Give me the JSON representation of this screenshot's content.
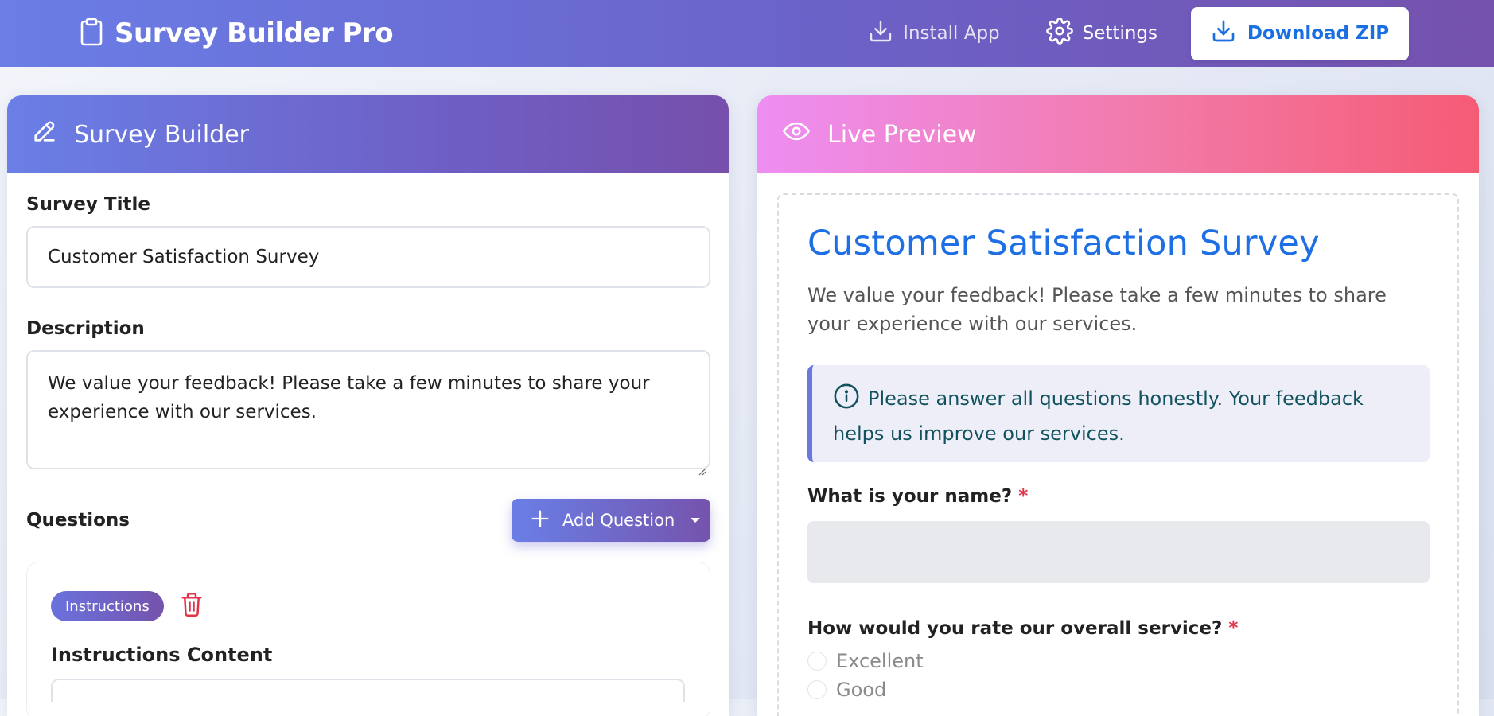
{
  "navbar": {
    "brand": "Survey Builder Pro",
    "install_label": "Install App",
    "settings_label": "Settings",
    "download_label": "Download ZIP"
  },
  "builder": {
    "header": "Survey Builder",
    "title_label": "Survey Title",
    "title_value": "Customer Satisfaction Survey",
    "description_label": "Description",
    "description_value": "We value your feedback! Please take a few minutes to share your experience with our services.",
    "questions_label": "Questions",
    "add_question_label": "Add Question",
    "question_card": {
      "badge": "Instructions",
      "content_label": "Instructions Content"
    }
  },
  "preview": {
    "header": "Live Preview",
    "title": "Customer Satisfaction Survey",
    "description": "We value your feedback! Please take a few minutes to share your experience with our services.",
    "info_text": "Please answer all questions honestly. Your feedback helps us improve our services.",
    "questions": [
      {
        "label": "What is your name?",
        "required": "*"
      },
      {
        "label": "How would you rate our overall service?",
        "required": "*",
        "options": [
          "Excellent",
          "Good"
        ]
      }
    ]
  },
  "colors": {
    "navbar_gradient_start": "#6a7ee6",
    "navbar_gradient_end": "#7552ad",
    "preview_gradient_start": "#ee8ef2",
    "preview_gradient_end": "#f55b75",
    "preview_title": "#1d6fe3",
    "required_asterisk": "#e0344a",
    "delete_icon": "#e0344a"
  },
  "icons": {
    "brand": "clipboard-icon",
    "install": "download-icon",
    "settings": "gear-icon",
    "download_zip": "download-icon",
    "builder_header": "pencil-icon",
    "preview_header": "eye-icon",
    "add_question": "plus-icon",
    "delete": "trash-icon",
    "info": "info-circle-icon"
  }
}
